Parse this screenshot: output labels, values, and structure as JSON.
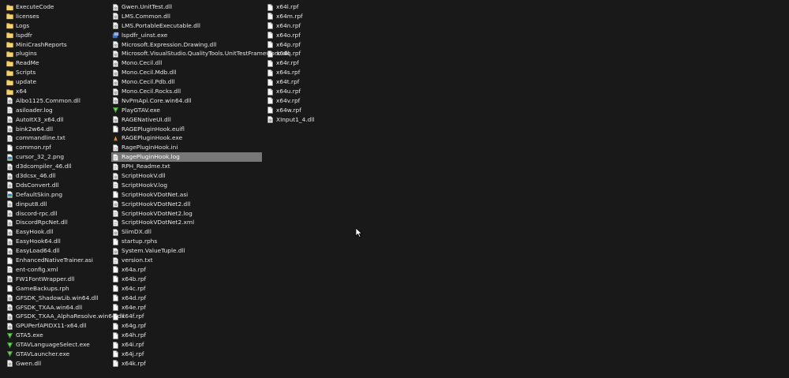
{
  "columns": [
    {
      "items": [
        {
          "name": "ExecuteCode",
          "icon": "folder-icon"
        },
        {
          "name": "licenses",
          "icon": "folder-icon"
        },
        {
          "name": "Logs",
          "icon": "folder-icon"
        },
        {
          "name": "lspdfr",
          "icon": "folder-icon"
        },
        {
          "name": "MiniCrashReports",
          "icon": "folder-icon"
        },
        {
          "name": "plugins",
          "icon": "folder-icon"
        },
        {
          "name": "ReadMe",
          "icon": "folder-icon"
        },
        {
          "name": "Scripts",
          "icon": "folder-icon"
        },
        {
          "name": "update",
          "icon": "folder-icon"
        },
        {
          "name": "x64",
          "icon": "folder-icon"
        },
        {
          "name": "Albo1125.Common.dll",
          "icon": "dll-file-icon"
        },
        {
          "name": "asiloader.log",
          "icon": "text-file-icon"
        },
        {
          "name": "AutoItX3_x64.dll",
          "icon": "dll-file-icon"
        },
        {
          "name": "bink2w64.dll",
          "icon": "dll-file-icon"
        },
        {
          "name": "commandline.txt",
          "icon": "text-file-icon"
        },
        {
          "name": "common.rpf",
          "icon": "file-icon"
        },
        {
          "name": "cursor_32_2.png",
          "icon": "image-file-icon"
        },
        {
          "name": "d3dcompiler_46.dll",
          "icon": "dll-file-icon"
        },
        {
          "name": "d3dcsx_46.dll",
          "icon": "dll-file-icon"
        },
        {
          "name": "DdsConvert.dll",
          "icon": "dll-file-icon"
        },
        {
          "name": "DefaultSkin.png",
          "icon": "image-file-icon"
        },
        {
          "name": "dinput8.dll",
          "icon": "dll-file-icon"
        },
        {
          "name": "discord-rpc.dll",
          "icon": "dll-file-icon"
        },
        {
          "name": "DiscordRpcNet.dll",
          "icon": "dll-file-icon"
        },
        {
          "name": "EasyHook.dll",
          "icon": "dll-file-icon"
        },
        {
          "name": "EasyHook64.dll",
          "icon": "dll-file-icon"
        },
        {
          "name": "EasyLoad64.dll",
          "icon": "dll-file-icon"
        },
        {
          "name": "EnhancedNativeTrainer.asi",
          "icon": "file-icon"
        },
        {
          "name": "ent-config.xml",
          "icon": "text-file-icon"
        },
        {
          "name": "FW1FontWrapper.dll",
          "icon": "dll-file-icon"
        },
        {
          "name": "GameBackups.rph",
          "icon": "file-icon"
        },
        {
          "name": "GFSDK_ShadowLib.win64.dll",
          "icon": "dll-file-icon"
        },
        {
          "name": "GFSDK_TXAA.win64.dll",
          "icon": "dll-file-icon"
        },
        {
          "name": "GFSDK_TXAA_AlphaResolve.win64.dll",
          "icon": "dll-file-icon"
        },
        {
          "name": "GPUPerfAPIDX11-x64.dll",
          "icon": "dll-file-icon"
        },
        {
          "name": "GTA5.exe",
          "icon": "gta-exe-icon"
        },
        {
          "name": "GTAVLanguageSelect.exe",
          "icon": "gta-exe-icon"
        },
        {
          "name": "GTAVLauncher.exe",
          "icon": "gta-exe-icon"
        },
        {
          "name": "Gwen.dll",
          "icon": "dll-file-icon"
        }
      ]
    },
    {
      "items": [
        {
          "name": "Gwen.UnitTest.dll",
          "icon": "dll-file-icon"
        },
        {
          "name": "LMS.Common.dll",
          "icon": "dll-file-icon"
        },
        {
          "name": "LMS.PortableExecutable.dll",
          "icon": "dll-file-icon"
        },
        {
          "name": "lspdfr_uinst.exe",
          "icon": "installer-exe-icon"
        },
        {
          "name": "Microsoft.Expression.Drawing.dll",
          "icon": "dll-file-icon"
        },
        {
          "name": "Microsoft.VisualStudio.QualityTools.UnitTestFramework.dll",
          "icon": "dll-file-icon"
        },
        {
          "name": "Mono.Cecil.dll",
          "icon": "dll-file-icon"
        },
        {
          "name": "Mono.Cecil.Mdb.dll",
          "icon": "dll-file-icon"
        },
        {
          "name": "Mono.Cecil.Pdb.dll",
          "icon": "dll-file-icon"
        },
        {
          "name": "Mono.Cecil.Rocks.dll",
          "icon": "dll-file-icon"
        },
        {
          "name": "NvPmApi.Core.win64.dll",
          "icon": "dll-file-icon"
        },
        {
          "name": "PlayGTAV.exe",
          "icon": "gta-exe-icon"
        },
        {
          "name": "RAGENativeUI.dll",
          "icon": "dll-file-icon"
        },
        {
          "name": "RAGEPluginHook.euifl",
          "icon": "file-icon"
        },
        {
          "name": "RAGEPluginHook.exe",
          "icon": "rph-exe-icon"
        },
        {
          "name": "RagePluginHook.ini",
          "icon": "settings-file-icon"
        },
        {
          "name": "RagePluginHook.log",
          "icon": "text-file-icon",
          "selected": true
        },
        {
          "name": "RPH_Readme.txt",
          "icon": "text-file-icon"
        },
        {
          "name": "ScriptHookV.dll",
          "icon": "dll-file-icon"
        },
        {
          "name": "ScriptHookV.log",
          "icon": "text-file-icon"
        },
        {
          "name": "ScriptHookVDotNet.asi",
          "icon": "file-icon"
        },
        {
          "name": "ScriptHookVDotNet2.dll",
          "icon": "dll-file-icon"
        },
        {
          "name": "ScriptHookVDotNet2.log",
          "icon": "text-file-icon"
        },
        {
          "name": "ScriptHookVDotNet2.xml",
          "icon": "text-file-icon"
        },
        {
          "name": "SlimDX.dll",
          "icon": "dll-file-icon"
        },
        {
          "name": "startup.rphs",
          "icon": "file-icon"
        },
        {
          "name": "System.ValueTuple.dll",
          "icon": "dll-file-icon"
        },
        {
          "name": "version.txt",
          "icon": "text-file-icon"
        },
        {
          "name": "x64a.rpf",
          "icon": "file-icon"
        },
        {
          "name": "x64b.rpf",
          "icon": "file-icon"
        },
        {
          "name": "x64c.rpf",
          "icon": "file-icon"
        },
        {
          "name": "x64d.rpf",
          "icon": "file-icon"
        },
        {
          "name": "x64e.rpf",
          "icon": "file-icon"
        },
        {
          "name": "x64f.rpf",
          "icon": "file-icon"
        },
        {
          "name": "x64g.rpf",
          "icon": "file-icon"
        },
        {
          "name": "x64h.rpf",
          "icon": "file-icon"
        },
        {
          "name": "x64i.rpf",
          "icon": "file-icon"
        },
        {
          "name": "x64j.rpf",
          "icon": "file-icon"
        },
        {
          "name": "x64k.rpf",
          "icon": "file-icon"
        }
      ]
    },
    {
      "items": [
        {
          "name": "x64l.rpf",
          "icon": "file-icon"
        },
        {
          "name": "x64m.rpf",
          "icon": "file-icon"
        },
        {
          "name": "x64n.rpf",
          "icon": "file-icon"
        },
        {
          "name": "x64o.rpf",
          "icon": "file-icon"
        },
        {
          "name": "x64p.rpf",
          "icon": "file-icon"
        },
        {
          "name": "x64q.rpf",
          "icon": "file-icon"
        },
        {
          "name": "x64r.rpf",
          "icon": "file-icon"
        },
        {
          "name": "x64s.rpf",
          "icon": "file-icon"
        },
        {
          "name": "x64t.rpf",
          "icon": "file-icon"
        },
        {
          "name": "x64u.rpf",
          "icon": "file-icon"
        },
        {
          "name": "x64v.rpf",
          "icon": "file-icon"
        },
        {
          "name": "x64w.rpf",
          "icon": "file-icon"
        },
        {
          "name": "XInput1_4.dll",
          "icon": "dll-file-icon"
        }
      ]
    }
  ],
  "colors": {
    "background": "#191919",
    "text": "#e6e6e6",
    "selection": "#777777",
    "folder": "#e8c25b"
  }
}
